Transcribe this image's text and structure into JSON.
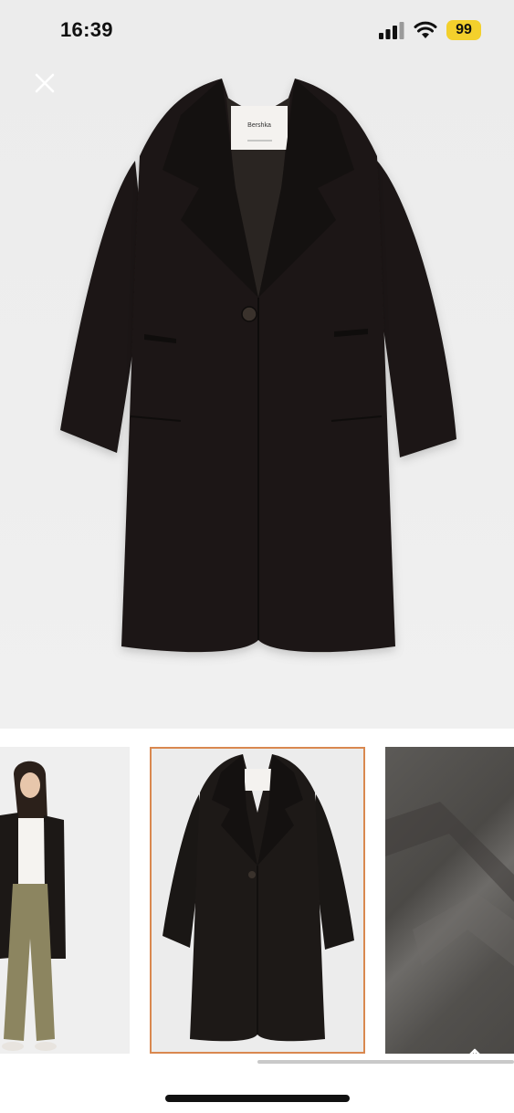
{
  "status_bar": {
    "time": "16:39",
    "battery": "99",
    "battery_color": "#f3d02c"
  },
  "close_button": {
    "icon": "close-icon"
  },
  "hero": {
    "coat_color": "#1a1715",
    "label_brand": "Bershka"
  },
  "thumbnails": [
    {
      "name": "model-photo",
      "selected": false
    },
    {
      "name": "coat-front",
      "selected": true
    },
    {
      "name": "fabric-detail",
      "selected": false
    }
  ],
  "selection_color": "#d9884f",
  "share_button": {
    "icon": "share-icon"
  }
}
